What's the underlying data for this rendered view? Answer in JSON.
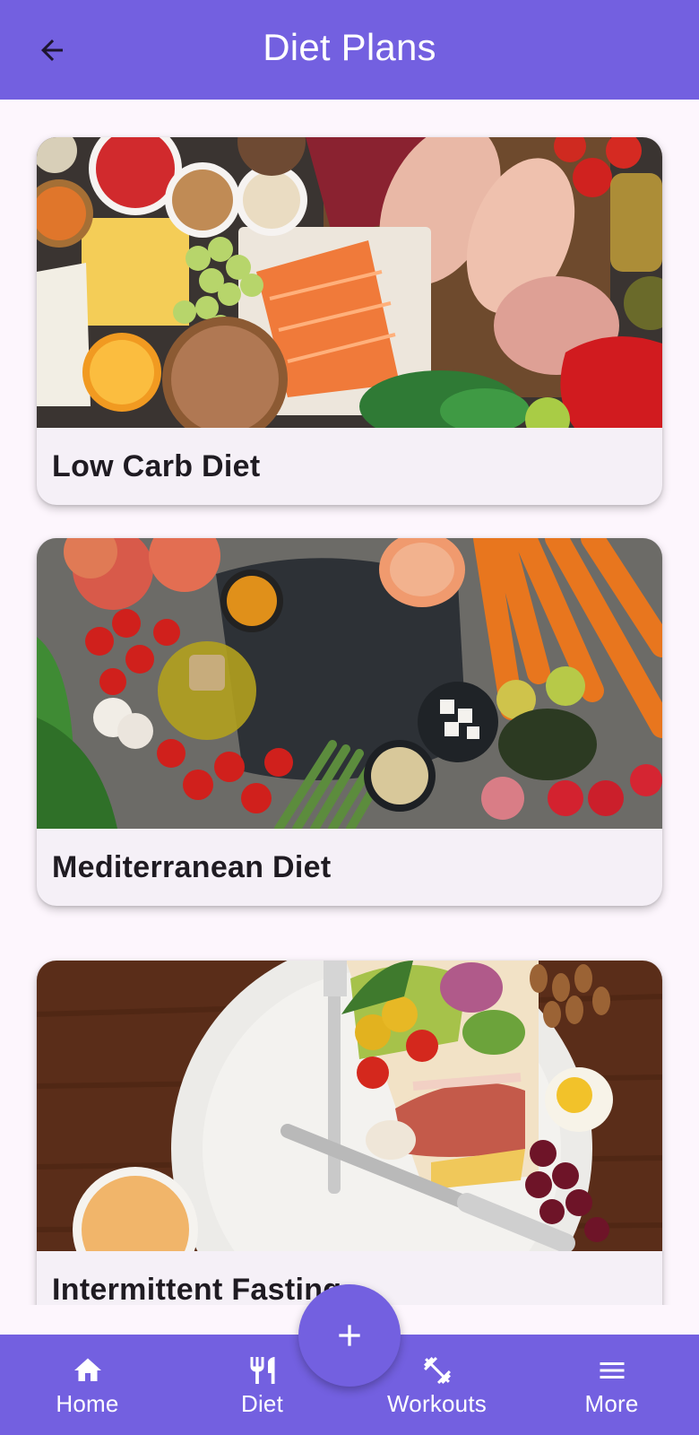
{
  "app_bar": {
    "title": "Diet Plans",
    "back_icon": "arrow-back-icon",
    "color": "#7360e0"
  },
  "diet_plans": [
    {
      "title": "Low Carb Diet",
      "image": "low-carb-food-spread-image"
    },
    {
      "title": "Mediterranean Diet",
      "image": "mediterranean-food-spread-image"
    },
    {
      "title": "Intermittent Fasting",
      "image": "plate-clock-fasting-image"
    }
  ],
  "fab": {
    "icon": "plus-icon"
  },
  "bottom_nav": {
    "items": [
      {
        "label": "Home",
        "icon": "home-icon"
      },
      {
        "label": "Diet",
        "icon": "fork-knife-icon"
      },
      {
        "label": "Workouts",
        "icon": "dumbbell-icon"
      },
      {
        "label": "More",
        "icon": "menu-icon"
      }
    ]
  },
  "colors": {
    "primary": "#7360e0",
    "background": "#fdf6fd",
    "card": "#f5f0f7",
    "title_text": "#1f1b22"
  }
}
